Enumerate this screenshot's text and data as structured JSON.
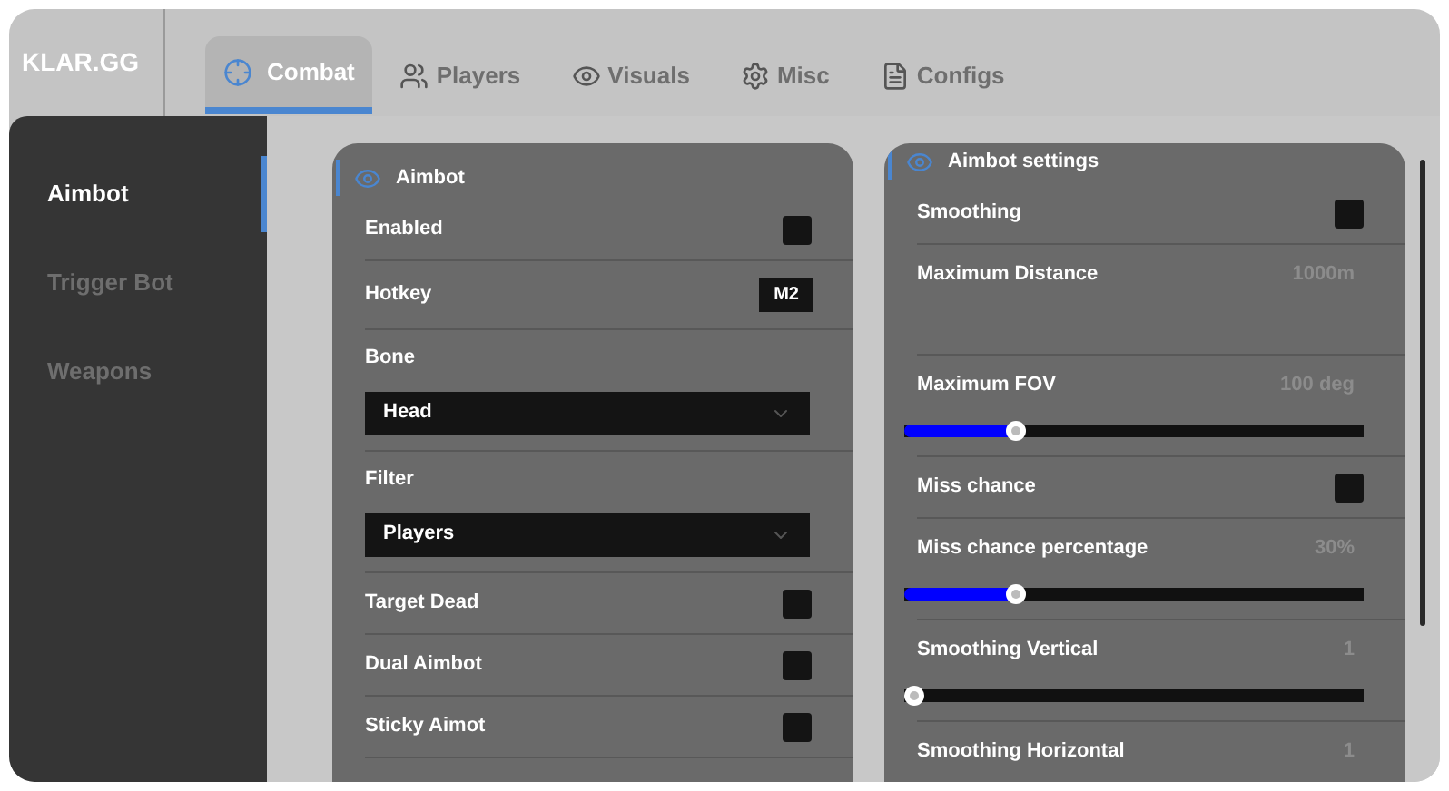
{
  "brand": "KLAR.GG",
  "tabs": [
    {
      "label": "Combat",
      "selected": true
    },
    {
      "label": "Players",
      "selected": false
    },
    {
      "label": "Visuals",
      "selected": false
    },
    {
      "label": "Misc",
      "selected": false
    },
    {
      "label": "Configs",
      "selected": false
    }
  ],
  "sidebar": {
    "items": [
      {
        "label": "Aimbot",
        "selected": true
      },
      {
        "label": "Trigger Bot",
        "selected": false
      },
      {
        "label": "Weapons",
        "selected": false
      }
    ]
  },
  "panels": [
    {
      "title": "Aimbot",
      "rows": [
        {
          "kind": "toggle",
          "label": "Enabled",
          "checked": false
        },
        {
          "kind": "key",
          "label": "Hotkey",
          "value": "M2"
        },
        {
          "kind": "dropdown",
          "label": "Bone",
          "value": "Head"
        },
        {
          "kind": "dropdown",
          "label": "Filter",
          "value": "Players"
        },
        {
          "kind": "toggle",
          "label": "Target Dead",
          "checked": false
        },
        {
          "kind": "toggle",
          "label": "Dual Aimbot",
          "checked": false
        },
        {
          "kind": "toggle",
          "label": "Sticky Aimot",
          "checked": false
        }
      ]
    },
    {
      "title": "Aimbot settings",
      "rows": [
        {
          "kind": "toggle",
          "label": "Smoothing",
          "checked": false
        },
        {
          "kind": "value",
          "label": "Maximum Distance",
          "reading": "1000m"
        },
        {
          "kind": "slider",
          "label": "Maximum FOV",
          "reading": "100 deg",
          "level": 0.23
        },
        {
          "kind": "toggle",
          "label": "Miss chance",
          "checked": false
        },
        {
          "kind": "slider",
          "label": "Miss chance percentage",
          "reading": "30%",
          "level": 0.23
        },
        {
          "kind": "slider",
          "label": "Smoothing Vertical",
          "reading": "1",
          "level": 0
        },
        {
          "kind": "value",
          "label": "Smoothing Horizontal",
          "reading": "1"
        }
      ]
    }
  ]
}
